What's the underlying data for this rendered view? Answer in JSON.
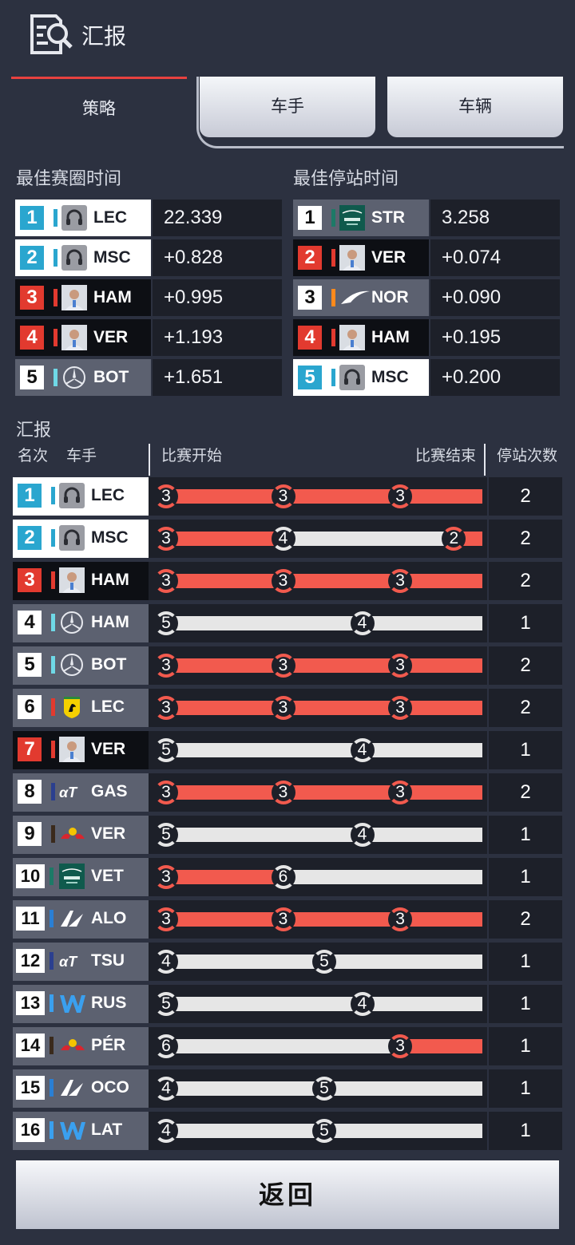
{
  "header": {
    "title": "汇报",
    "icon": "report-search-icon"
  },
  "tabs": [
    {
      "label": "策略",
      "active": true
    },
    {
      "label": "车手",
      "active": false
    },
    {
      "label": "车辆",
      "active": false
    }
  ],
  "colors": {
    "soft": "#f25a4e",
    "medium": "#e6e6e6",
    "hard": "#e6e6e6",
    "accent": "#e8413f"
  },
  "best_lap": {
    "label": "最佳赛圈时间",
    "rows": [
      {
        "pos": "1",
        "driver": "LEC",
        "time": "22.339",
        "theme": "white",
        "pos_color": "#2aa6cf",
        "team_color": "#2aa6cf",
        "avatar": "headset-icon"
      },
      {
        "pos": "2",
        "driver": "MSC",
        "time": "+0.828",
        "theme": "white",
        "pos_color": "#2aa6cf",
        "team_color": "#2aa6cf",
        "avatar": "headset-icon"
      },
      {
        "pos": "3",
        "driver": "HAM",
        "time": "+0.995",
        "theme": "black",
        "pos_color": "#e23a2f",
        "team_color": "#e23a2f",
        "avatar": "driver-photo"
      },
      {
        "pos": "4",
        "driver": "VER",
        "time": "+1.193",
        "theme": "black",
        "pos_color": "#e23a2f",
        "team_color": "#e23a2f",
        "avatar": "driver-photo"
      },
      {
        "pos": "5",
        "driver": "BOT",
        "time": "+1.651",
        "theme": "grey",
        "pos_color": "#ffffff",
        "team_color": "#6fd8e6",
        "avatar": "mercedes-star-icon"
      }
    ]
  },
  "best_pit": {
    "label": "最佳停站时间",
    "rows": [
      {
        "pos": "1",
        "driver": "STR",
        "time": "3.258",
        "theme": "grey",
        "pos_color": "#ffffff",
        "team_color": "#1d7a67",
        "avatar": "aston-martin-logo"
      },
      {
        "pos": "2",
        "driver": "VER",
        "time": "+0.074",
        "theme": "black",
        "pos_color": "#e23a2f",
        "team_color": "#e23a2f",
        "avatar": "driver-photo"
      },
      {
        "pos": "3",
        "driver": "NOR",
        "time": "+0.090",
        "theme": "grey",
        "pos_color": "#ffffff",
        "team_color": "#ff8a1c",
        "avatar": "mclaren-swoosh-icon"
      },
      {
        "pos": "4",
        "driver": "HAM",
        "time": "+0.195",
        "theme": "black",
        "pos_color": "#e23a2f",
        "team_color": "#e23a2f",
        "avatar": "driver-photo"
      },
      {
        "pos": "5",
        "driver": "MSC",
        "time": "+0.200",
        "theme": "white",
        "pos_color": "#2aa6cf",
        "team_color": "#2aa6cf",
        "avatar": "headset-icon"
      }
    ]
  },
  "report": {
    "label": "汇报",
    "headers": {
      "rank": "名次",
      "driver": "车手",
      "start": "比赛开始",
      "end": "比赛结束",
      "stops": "停站次数"
    },
    "rows": [
      {
        "pos": "1",
        "driver": "LEC",
        "stops": "2",
        "theme": "white",
        "pos_color": "#2aa6cf",
        "team_color": "#2aa6cf",
        "avatar": "headset-icon",
        "stints": [
          {
            "tyre": "3",
            "end_frac": 0.37
          },
          {
            "tyre": "3",
            "end_frac": 0.74
          },
          {
            "tyre": "3",
            "end_frac": 1.0
          }
        ]
      },
      {
        "pos": "2",
        "driver": "MSC",
        "stops": "2",
        "theme": "white",
        "pos_color": "#2aa6cf",
        "team_color": "#2aa6cf",
        "avatar": "headset-icon",
        "stints": [
          {
            "tyre": "3",
            "end_frac": 0.37
          },
          {
            "tyre": "4",
            "end_frac": 0.91
          },
          {
            "tyre": "2",
            "end_frac": 1.0
          }
        ]
      },
      {
        "pos": "3",
        "driver": "HAM",
        "stops": "2",
        "theme": "black",
        "pos_color": "#e23a2f",
        "team_color": "#e23a2f",
        "avatar": "driver-photo",
        "stints": [
          {
            "tyre": "3",
            "end_frac": 0.37
          },
          {
            "tyre": "3",
            "end_frac": 0.74
          },
          {
            "tyre": "3",
            "end_frac": 1.0
          }
        ]
      },
      {
        "pos": "4",
        "driver": "HAM",
        "stops": "1",
        "theme": "grey",
        "pos_color": "#ffffff",
        "team_color": "#6fd8e6",
        "avatar": "mercedes-star-icon",
        "stints": [
          {
            "tyre": "5",
            "end_frac": 0.62
          },
          {
            "tyre": "4",
            "end_frac": 1.0
          }
        ]
      },
      {
        "pos": "5",
        "driver": "BOT",
        "stops": "2",
        "theme": "grey",
        "pos_color": "#ffffff",
        "team_color": "#6fd8e6",
        "avatar": "mercedes-star-icon",
        "stints": [
          {
            "tyre": "3",
            "end_frac": 0.37
          },
          {
            "tyre": "3",
            "end_frac": 0.74
          },
          {
            "tyre": "3",
            "end_frac": 1.0
          }
        ]
      },
      {
        "pos": "6",
        "driver": "LEC",
        "stops": "2",
        "theme": "grey",
        "pos_color": "#ffffff",
        "team_color": "#e23a2f",
        "avatar": "ferrari-horse-icon",
        "stints": [
          {
            "tyre": "3",
            "end_frac": 0.37
          },
          {
            "tyre": "3",
            "end_frac": 0.74
          },
          {
            "tyre": "3",
            "end_frac": 1.0
          }
        ]
      },
      {
        "pos": "7",
        "driver": "VER",
        "stops": "1",
        "theme": "black",
        "pos_color": "#e23a2f",
        "team_color": "#e23a2f",
        "avatar": "driver-photo",
        "stints": [
          {
            "tyre": "5",
            "end_frac": 0.62
          },
          {
            "tyre": "4",
            "end_frac": 1.0
          }
        ]
      },
      {
        "pos": "8",
        "driver": "GAS",
        "stops": "2",
        "theme": "grey",
        "pos_color": "#ffffff",
        "team_color": "#2b3f8f",
        "avatar": "alphatauri-logo",
        "stints": [
          {
            "tyre": "3",
            "end_frac": 0.37
          },
          {
            "tyre": "3",
            "end_frac": 0.74
          },
          {
            "tyre": "3",
            "end_frac": 1.0
          }
        ]
      },
      {
        "pos": "9",
        "driver": "VER",
        "stops": "1",
        "theme": "grey",
        "pos_color": "#ffffff",
        "team_color": "#3a2a1c",
        "avatar": "red-bull-logo",
        "stints": [
          {
            "tyre": "5",
            "end_frac": 0.62
          },
          {
            "tyre": "4",
            "end_frac": 1.0
          }
        ]
      },
      {
        "pos": "10",
        "driver": "VET",
        "stops": "1",
        "theme": "grey",
        "pos_color": "#ffffff",
        "team_color": "#1d7a67",
        "avatar": "aston-martin-logo",
        "stints": [
          {
            "tyre": "3",
            "end_frac": 0.37
          },
          {
            "tyre": "6",
            "end_frac": 1.0
          }
        ]
      },
      {
        "pos": "11",
        "driver": "ALO",
        "stops": "2",
        "theme": "grey",
        "pos_color": "#ffffff",
        "team_color": "#2a7fd4",
        "avatar": "alpine-logo",
        "stints": [
          {
            "tyre": "3",
            "end_frac": 0.37
          },
          {
            "tyre": "3",
            "end_frac": 0.74
          },
          {
            "tyre": "3",
            "end_frac": 1.0
          }
        ]
      },
      {
        "pos": "12",
        "driver": "TSU",
        "stops": "1",
        "theme": "grey",
        "pos_color": "#ffffff",
        "team_color": "#2b3f8f",
        "avatar": "alphatauri-logo",
        "stints": [
          {
            "tyre": "4",
            "end_frac": 0.5
          },
          {
            "tyre": "5",
            "end_frac": 1.0
          }
        ]
      },
      {
        "pos": "13",
        "driver": "RUS",
        "stops": "1",
        "theme": "grey",
        "pos_color": "#ffffff",
        "team_color": "#3aa0ef",
        "avatar": "williams-logo",
        "stints": [
          {
            "tyre": "5",
            "end_frac": 0.62
          },
          {
            "tyre": "4",
            "end_frac": 1.0
          }
        ]
      },
      {
        "pos": "14",
        "driver": "PÉR",
        "stops": "1",
        "theme": "grey",
        "pos_color": "#ffffff",
        "team_color": "#3a2a1c",
        "avatar": "red-bull-logo",
        "stints": [
          {
            "tyre": "6",
            "end_frac": 0.74
          },
          {
            "tyre": "3",
            "end_frac": 1.0
          }
        ]
      },
      {
        "pos": "15",
        "driver": "OCO",
        "stops": "1",
        "theme": "grey",
        "pos_color": "#ffffff",
        "team_color": "#2a7fd4",
        "avatar": "alpine-logo",
        "stints": [
          {
            "tyre": "4",
            "end_frac": 0.5
          },
          {
            "tyre": "5",
            "end_frac": 1.0
          }
        ]
      },
      {
        "pos": "16",
        "driver": "LAT",
        "stops": "1",
        "theme": "grey",
        "pos_color": "#ffffff",
        "team_color": "#3aa0ef",
        "avatar": "williams-logo",
        "stints": [
          {
            "tyre": "4",
            "end_frac": 0.5
          },
          {
            "tyre": "5",
            "end_frac": 1.0
          }
        ]
      }
    ]
  },
  "footer": {
    "back_label": "返回"
  }
}
